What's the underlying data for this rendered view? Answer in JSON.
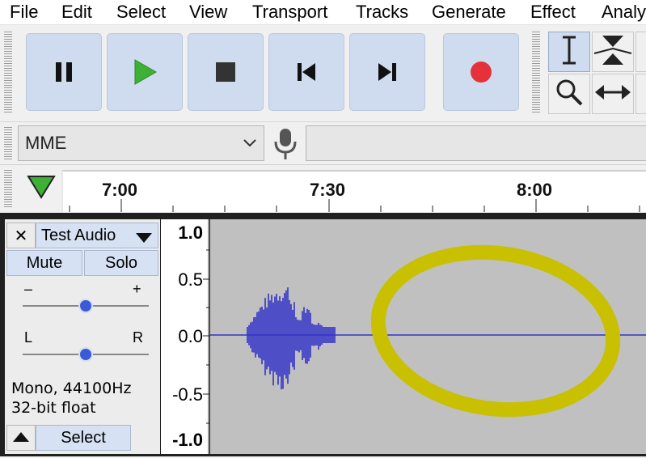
{
  "menu": {
    "items": [
      "File",
      "Edit",
      "Select",
      "View",
      "Transport",
      "Tracks",
      "Generate",
      "Effect",
      "Analy"
    ]
  },
  "transport": {
    "pause_icon": "pause-icon",
    "play_icon": "play-icon",
    "stop_icon": "stop-icon",
    "skip_start_icon": "skip-to-start-icon",
    "skip_end_icon": "skip-to-end-icon",
    "record_icon": "record-icon",
    "colors": {
      "button_bg": "#cfdcef",
      "play": "#3db035",
      "record": "#e5323a"
    }
  },
  "tools": [
    "selection-tool-icon",
    "envelope-tool-icon",
    "zoom-tool-icon",
    "time-shift-tool-icon"
  ],
  "device": {
    "host": "MME",
    "mic_icon": "microphone-icon"
  },
  "timeline": {
    "ticks": [
      "7:00",
      "7:30",
      "8:00"
    ],
    "play_head_color": "#3db035"
  },
  "track": {
    "name": "Test Audio",
    "close_label": "✕",
    "mute_label": "Mute",
    "solo_label": "Solo",
    "gain_minus": "–",
    "gain_plus": "+",
    "pan_left": "L",
    "pan_right": "R",
    "info_line1": "Mono, 44100Hz",
    "info_line2": "32-bit float",
    "select_label": "Select",
    "gain_level": 0.5,
    "pan_level": 0.5
  },
  "vruler": [
    "1.0",
    "0.5",
    "0.0",
    "-0.5",
    "-1.0"
  ],
  "colors": {
    "waveform": "#3232c8",
    "annotation": "#c8c000",
    "wave_bg": "#c0c0c0"
  }
}
